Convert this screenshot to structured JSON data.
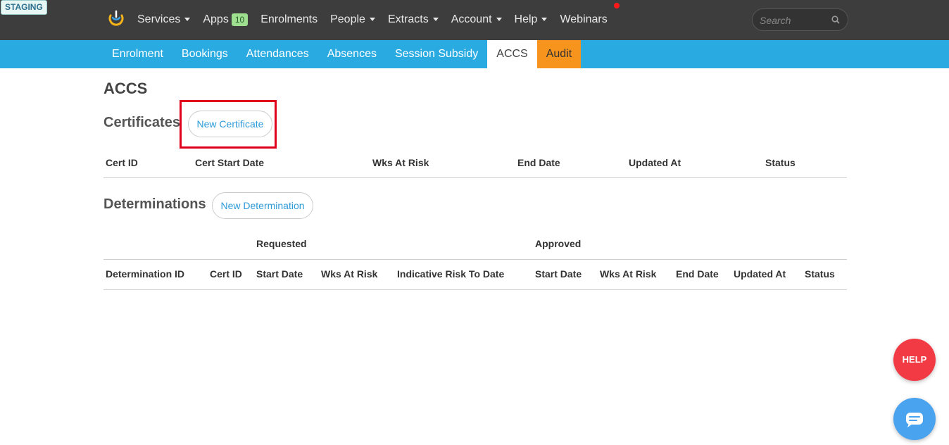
{
  "environment_badge": "STAGING",
  "topnav": {
    "items": [
      {
        "label": "Services",
        "caret": true
      },
      {
        "label": "Apps",
        "badge": "10"
      },
      {
        "label": "Enrolments"
      },
      {
        "label": "People",
        "caret": true
      },
      {
        "label": "Extracts",
        "caret": true
      },
      {
        "label": "Account",
        "caret": true
      },
      {
        "label": "Help",
        "caret": true
      },
      {
        "label": "Webinars",
        "notification_dot": true
      }
    ],
    "search_placeholder": "Search"
  },
  "subnav": {
    "items": [
      {
        "label": "Enrolment"
      },
      {
        "label": "Bookings"
      },
      {
        "label": "Attendances"
      },
      {
        "label": "Absences"
      },
      {
        "label": "Session Subsidy"
      },
      {
        "label": "ACCS",
        "active": true
      },
      {
        "label": "Audit"
      }
    ]
  },
  "page": {
    "title": "ACCS"
  },
  "certificates": {
    "title": "Certificates",
    "button": "New Certificate",
    "columns": [
      "Cert ID",
      "Cert Start Date",
      "Wks At Risk",
      "End Date",
      "Updated At",
      "Status"
    ]
  },
  "determinations": {
    "title": "Determinations",
    "button": "New Determination",
    "group_headers": {
      "requested": "Requested",
      "approved": "Approved"
    },
    "columns": [
      "Determination ID",
      "Cert ID",
      "Start Date",
      "Wks At Risk",
      "Indicative Risk To Date",
      "Start Date",
      "Wks At Risk",
      "End Date",
      "Updated At",
      "Status"
    ]
  },
  "widgets": {
    "help_label": "HELP",
    "chat_icon": "chat-bubble-icon"
  },
  "colors": {
    "topbar": "#3d3d3d",
    "subnav": "#29abe2",
    "audit_tab": "#f7941d",
    "help_button": "#f23a45",
    "chat_button": "#4aa3ee",
    "highlight": "#e0001b",
    "link": "#2d9ad8"
  }
}
